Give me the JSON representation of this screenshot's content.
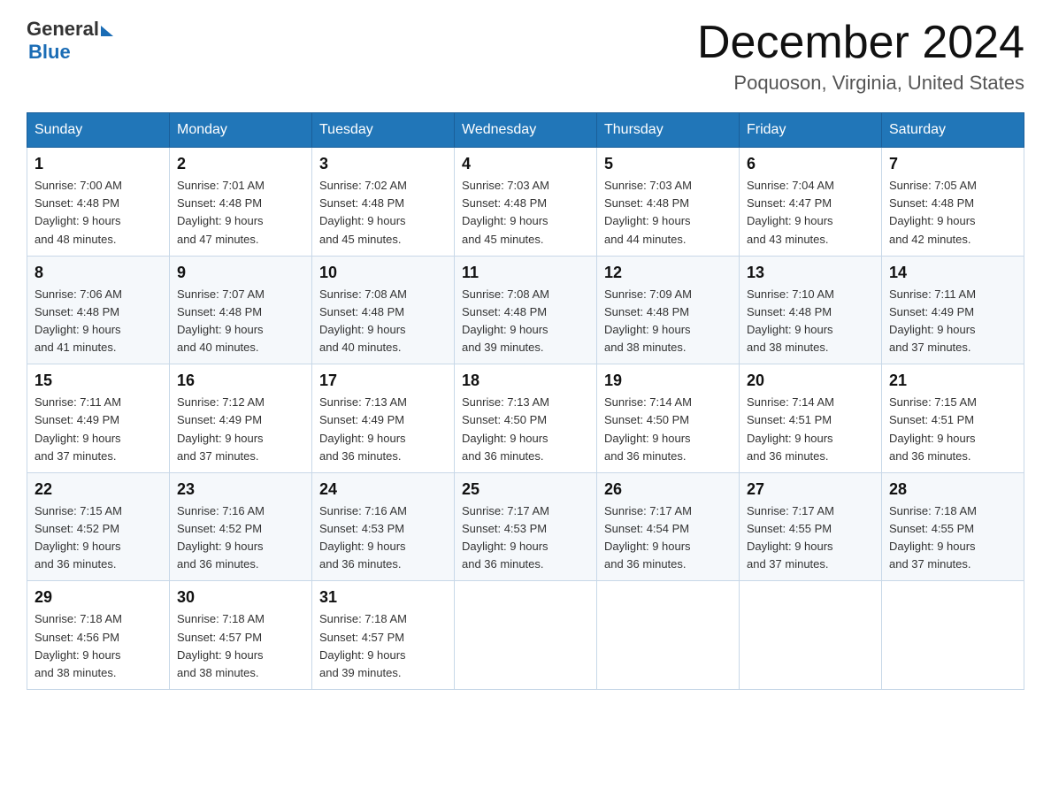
{
  "header": {
    "logo_general": "General",
    "logo_blue": "Blue",
    "month_title": "December 2024",
    "location": "Poquoson, Virginia, United States"
  },
  "weekdays": [
    "Sunday",
    "Monday",
    "Tuesday",
    "Wednesday",
    "Thursday",
    "Friday",
    "Saturday"
  ],
  "weeks": [
    [
      {
        "day": "1",
        "sunrise": "7:00 AM",
        "sunset": "4:48 PM",
        "daylight": "9 hours and 48 minutes."
      },
      {
        "day": "2",
        "sunrise": "7:01 AM",
        "sunset": "4:48 PM",
        "daylight": "9 hours and 47 minutes."
      },
      {
        "day": "3",
        "sunrise": "7:02 AM",
        "sunset": "4:48 PM",
        "daylight": "9 hours and 45 minutes."
      },
      {
        "day": "4",
        "sunrise": "7:03 AM",
        "sunset": "4:48 PM",
        "daylight": "9 hours and 45 minutes."
      },
      {
        "day": "5",
        "sunrise": "7:03 AM",
        "sunset": "4:48 PM",
        "daylight": "9 hours and 44 minutes."
      },
      {
        "day": "6",
        "sunrise": "7:04 AM",
        "sunset": "4:47 PM",
        "daylight": "9 hours and 43 minutes."
      },
      {
        "day": "7",
        "sunrise": "7:05 AM",
        "sunset": "4:48 PM",
        "daylight": "9 hours and 42 minutes."
      }
    ],
    [
      {
        "day": "8",
        "sunrise": "7:06 AM",
        "sunset": "4:48 PM",
        "daylight": "9 hours and 41 minutes."
      },
      {
        "day": "9",
        "sunrise": "7:07 AM",
        "sunset": "4:48 PM",
        "daylight": "9 hours and 40 minutes."
      },
      {
        "day": "10",
        "sunrise": "7:08 AM",
        "sunset": "4:48 PM",
        "daylight": "9 hours and 40 minutes."
      },
      {
        "day": "11",
        "sunrise": "7:08 AM",
        "sunset": "4:48 PM",
        "daylight": "9 hours and 39 minutes."
      },
      {
        "day": "12",
        "sunrise": "7:09 AM",
        "sunset": "4:48 PM",
        "daylight": "9 hours and 38 minutes."
      },
      {
        "day": "13",
        "sunrise": "7:10 AM",
        "sunset": "4:48 PM",
        "daylight": "9 hours and 38 minutes."
      },
      {
        "day": "14",
        "sunrise": "7:11 AM",
        "sunset": "4:49 PM",
        "daylight": "9 hours and 37 minutes."
      }
    ],
    [
      {
        "day": "15",
        "sunrise": "7:11 AM",
        "sunset": "4:49 PM",
        "daylight": "9 hours and 37 minutes."
      },
      {
        "day": "16",
        "sunrise": "7:12 AM",
        "sunset": "4:49 PM",
        "daylight": "9 hours and 37 minutes."
      },
      {
        "day": "17",
        "sunrise": "7:13 AM",
        "sunset": "4:49 PM",
        "daylight": "9 hours and 36 minutes."
      },
      {
        "day": "18",
        "sunrise": "7:13 AM",
        "sunset": "4:50 PM",
        "daylight": "9 hours and 36 minutes."
      },
      {
        "day": "19",
        "sunrise": "7:14 AM",
        "sunset": "4:50 PM",
        "daylight": "9 hours and 36 minutes."
      },
      {
        "day": "20",
        "sunrise": "7:14 AM",
        "sunset": "4:51 PM",
        "daylight": "9 hours and 36 minutes."
      },
      {
        "day": "21",
        "sunrise": "7:15 AM",
        "sunset": "4:51 PM",
        "daylight": "9 hours and 36 minutes."
      }
    ],
    [
      {
        "day": "22",
        "sunrise": "7:15 AM",
        "sunset": "4:52 PM",
        "daylight": "9 hours and 36 minutes."
      },
      {
        "day": "23",
        "sunrise": "7:16 AM",
        "sunset": "4:52 PM",
        "daylight": "9 hours and 36 minutes."
      },
      {
        "day": "24",
        "sunrise": "7:16 AM",
        "sunset": "4:53 PM",
        "daylight": "9 hours and 36 minutes."
      },
      {
        "day": "25",
        "sunrise": "7:17 AM",
        "sunset": "4:53 PM",
        "daylight": "9 hours and 36 minutes."
      },
      {
        "day": "26",
        "sunrise": "7:17 AM",
        "sunset": "4:54 PM",
        "daylight": "9 hours and 36 minutes."
      },
      {
        "day": "27",
        "sunrise": "7:17 AM",
        "sunset": "4:55 PM",
        "daylight": "9 hours and 37 minutes."
      },
      {
        "day": "28",
        "sunrise": "7:18 AM",
        "sunset": "4:55 PM",
        "daylight": "9 hours and 37 minutes."
      }
    ],
    [
      {
        "day": "29",
        "sunrise": "7:18 AM",
        "sunset": "4:56 PM",
        "daylight": "9 hours and 38 minutes."
      },
      {
        "day": "30",
        "sunrise": "7:18 AM",
        "sunset": "4:57 PM",
        "daylight": "9 hours and 38 minutes."
      },
      {
        "day": "31",
        "sunrise": "7:18 AM",
        "sunset": "4:57 PM",
        "daylight": "9 hours and 39 minutes."
      },
      null,
      null,
      null,
      null
    ]
  ],
  "labels": {
    "sunrise": "Sunrise:",
    "sunset": "Sunset:",
    "daylight": "Daylight:"
  }
}
